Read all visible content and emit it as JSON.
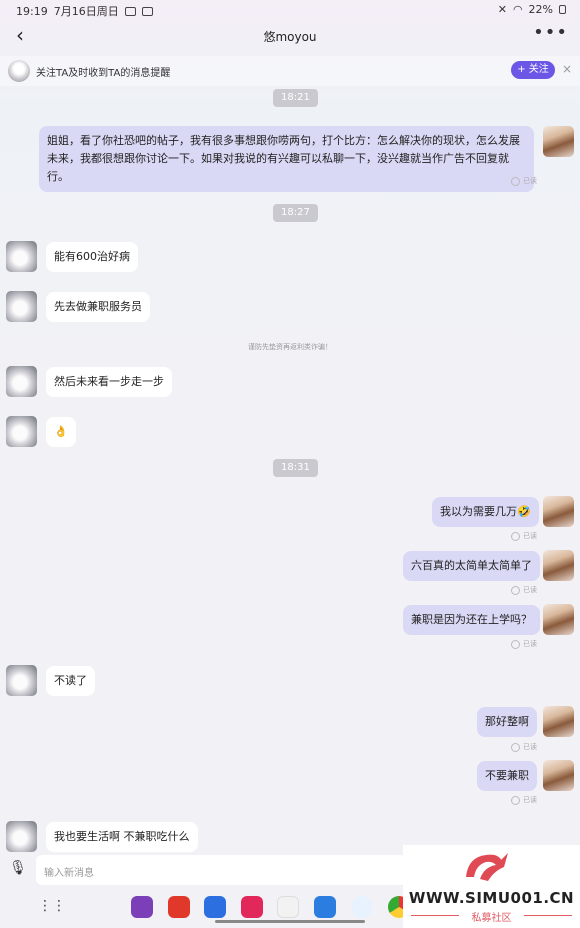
{
  "status": {
    "time": "19:19",
    "date": "7月16日周日",
    "battery": "22%"
  },
  "header": {
    "title": "悠moyou"
  },
  "follow": {
    "text": "关注TA及时收到TA的消息提醒",
    "button": "+ 关注",
    "close": "×"
  },
  "messages": {
    "t1": "18:21",
    "m1": "姐姐，看了你社恐吧的帖子，我有很多事想跟你唠两句，打个比方：怎么解决你的现状，怎么发展未来，我都很想跟你讨论一下。如果对我说的有兴趣可以私聊一下，没兴趣就当作广告不回复就行。",
    "t2": "18:27",
    "m2": "能有600治好病",
    "m3": "先去做兼职服务员",
    "notice": "谨防先垫资再返利类诈骗！",
    "m4": "然后未来看一步走一步",
    "m5": "👌",
    "t3": "18:31",
    "m6": "我以为需要几万🤣",
    "m7": "六百真的太简单太简单了",
    "m8": "兼职是因为还在上学吗？",
    "m9": "不读了",
    "m10": "那好整啊",
    "m11": "不要兼职",
    "m12": "我也要生活啊 不兼职吃什么",
    "read": "已读"
  },
  "input": {
    "placeholder": "输入新消息"
  },
  "watermark": {
    "url": "WWW.SIMU001.CN",
    "sub": "私募社区"
  },
  "colors": {
    "follow_button": "#6b57e6",
    "my_bubble": "#d9d9f6",
    "their_bubble": "#ffffff"
  }
}
